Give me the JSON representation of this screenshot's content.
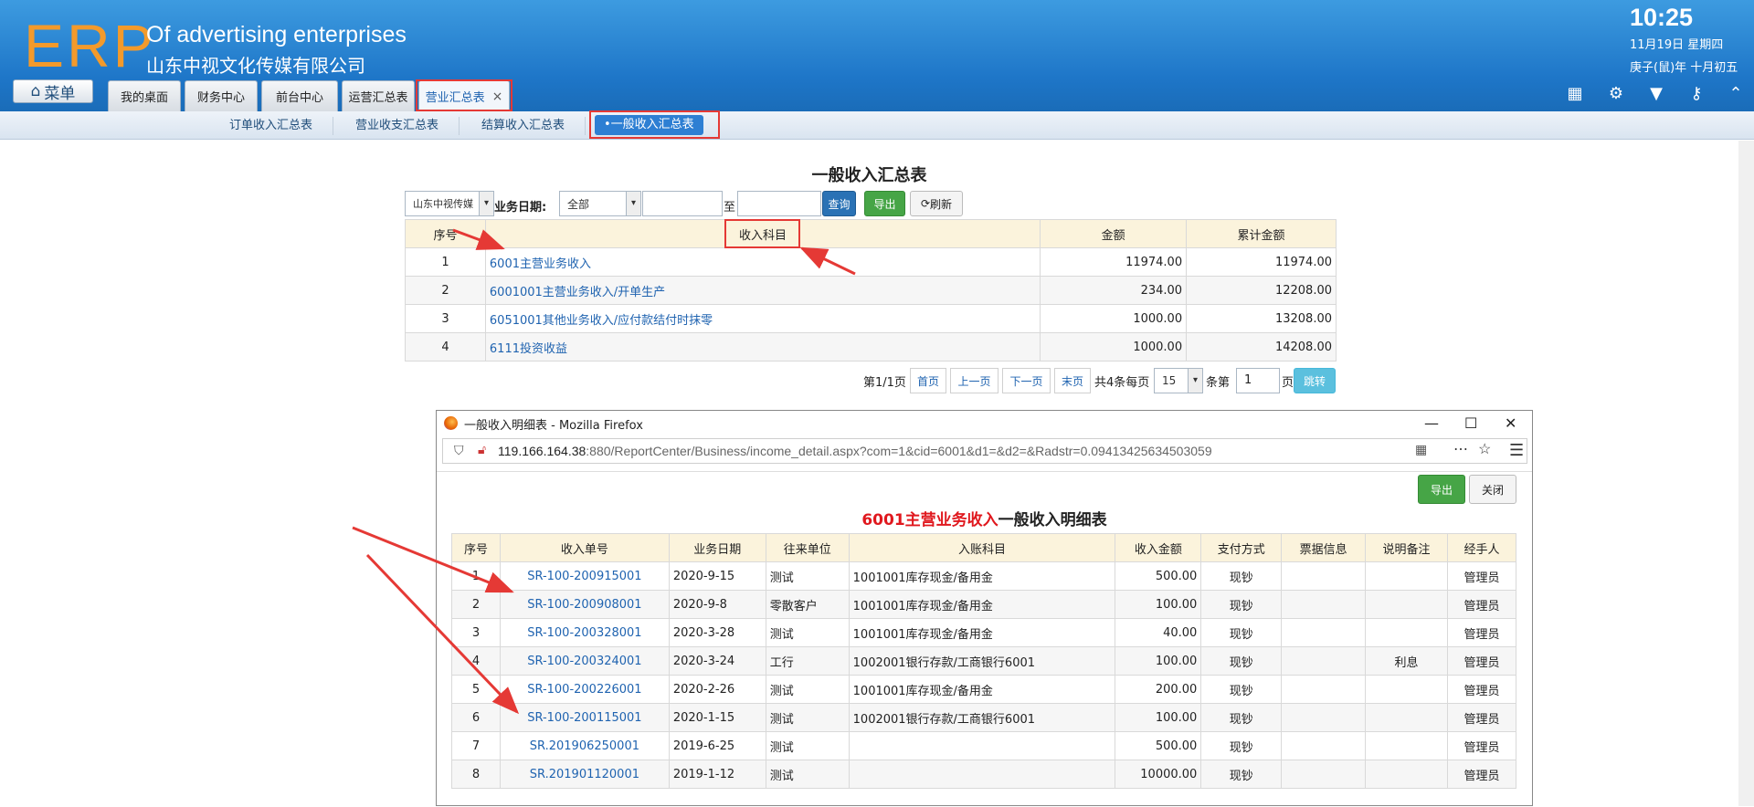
{
  "header": {
    "logo": "ERP",
    "title_en": "Of advertising enterprises",
    "title_cn": "山东中视文化传媒有限公司",
    "menu_label": "菜单",
    "clock": "10:25",
    "date_line1": "11月19日 星期四",
    "date_line2": "庚子(鼠)年 十月初五"
  },
  "tabs": [
    {
      "label": "我的桌面"
    },
    {
      "label": "财务中心"
    },
    {
      "label": "前台中心"
    },
    {
      "label": "运营汇总表"
    },
    {
      "label": "营业汇总表",
      "close": "×"
    }
  ],
  "toolbar_icons": [
    "grid-plus-icon",
    "gear-icon",
    "shirt-icon",
    "key-icon",
    "chevron-up-icon"
  ],
  "subtabs": [
    {
      "label": "订单收入汇总表"
    },
    {
      "label": "营业收支汇总表"
    },
    {
      "label": "结算收入汇总表"
    },
    {
      "label": "•一般收入汇总表"
    }
  ],
  "report": {
    "title": "一般收入汇总表",
    "company_select": "山东中视传媒",
    "date_label": "业务日期:",
    "date_range_select": "全部",
    "to_label": "至",
    "query_btn": "查询",
    "export_btn": "导出",
    "refresh_btn": "刷新",
    "columns": [
      "序号",
      "收入科目",
      "金额",
      "累计金额"
    ],
    "rows": [
      {
        "no": "1",
        "subject": "6001主营业务收入",
        "amount": "11974.00",
        "cumulative": "11974.00"
      },
      {
        "no": "2",
        "subject": "6001001主营业务收入/开单生产",
        "amount": "234.00",
        "cumulative": "12208.00"
      },
      {
        "no": "3",
        "subject": "6051001其他业务收入/应付款结付时抹零",
        "amount": "1000.00",
        "cumulative": "13208.00"
      },
      {
        "no": "4",
        "subject": "6111投资收益",
        "amount": "1000.00",
        "cumulative": "14208.00"
      }
    ],
    "pagination": {
      "page_info": "第1/1页",
      "first": "首页",
      "prev": "上一页",
      "next": "下一页",
      "last": "末页",
      "total_info": "共4条每页",
      "page_size": "15",
      "items_label": "条第",
      "page_input": "1",
      "page_label": "页",
      "jump": "跳转"
    }
  },
  "popup": {
    "window_title": "一般收入明细表 - Mozilla Firefox",
    "url_host": "119.166.164.38",
    "url_rest": ":880/ReportCenter/Business/income_detail.aspx?com=1&cid=6001&d1=&d2=&Radstr=0.09413425634503059",
    "export_btn": "导出",
    "close_btn": "关闭",
    "title_red": "6001主营业务收入",
    "title_black": "一般收入明细表",
    "columns": [
      "序号",
      "收入单号",
      "业务日期",
      "往来单位",
      "入账科目",
      "收入金额",
      "支付方式",
      "票据信息",
      "说明备注",
      "经手人"
    ],
    "rows": [
      {
        "no": "1",
        "doc": "SR-100-200915001",
        "date": "2020-9-15",
        "party": "测试",
        "account": "1001001库存现金/备用金",
        "amount": "500.00",
        "pay": "现钞",
        "bill": "",
        "note": "",
        "handler": "管理员"
      },
      {
        "no": "2",
        "doc": "SR-100-200908001",
        "date": "2020-9-8",
        "party": "零散客户",
        "account": "1001001库存现金/备用金",
        "amount": "100.00",
        "pay": "现钞",
        "bill": "",
        "note": "",
        "handler": "管理员"
      },
      {
        "no": "3",
        "doc": "SR-100-200328001",
        "date": "2020-3-28",
        "party": "测试",
        "account": "1001001库存现金/备用金",
        "amount": "40.00",
        "pay": "现钞",
        "bill": "",
        "note": "",
        "handler": "管理员"
      },
      {
        "no": "4",
        "doc": "SR-100-200324001",
        "date": "2020-3-24",
        "party": "工行",
        "account": "1002001银行存款/工商银行6001",
        "amount": "100.00",
        "pay": "现钞",
        "bill": "",
        "note": "利息",
        "handler": "管理员"
      },
      {
        "no": "5",
        "doc": "SR-100-200226001",
        "date": "2020-2-26",
        "party": "测试",
        "account": "1001001库存现金/备用金",
        "amount": "200.00",
        "pay": "现钞",
        "bill": "",
        "note": "",
        "handler": "管理员"
      },
      {
        "no": "6",
        "doc": "SR-100-200115001",
        "date": "2020-1-15",
        "party": "测试",
        "account": "1002001银行存款/工商银行6001",
        "amount": "100.00",
        "pay": "现钞",
        "bill": "",
        "note": "",
        "handler": "管理员"
      },
      {
        "no": "7",
        "doc": "SR.201906250001",
        "date": "2019-6-25",
        "party": "测试",
        "account": "",
        "amount": "500.00",
        "pay": "现钞",
        "bill": "",
        "note": "",
        "handler": "管理员"
      },
      {
        "no": "8",
        "doc": "SR.201901120001",
        "date": "2019-1-12",
        "party": "测试",
        "account": "",
        "amount": "10000.00",
        "pay": "现钞",
        "bill": "",
        "note": "",
        "handler": "管理员"
      }
    ]
  },
  "colors": {
    "accent": "#2a72b5",
    "highlight_red": "#e53935",
    "header_bg": "#1e76c8",
    "logo": "#f39a2b"
  }
}
